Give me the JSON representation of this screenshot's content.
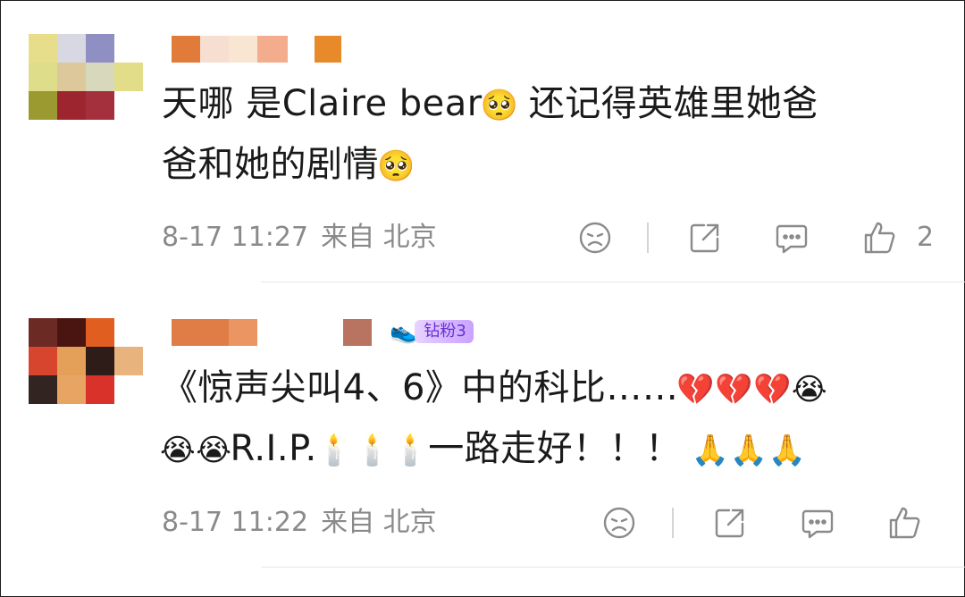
{
  "comments": [
    {
      "text_lines": [
        [
          {
            "t": "天哪 是Claire bear"
          },
          {
            "e": "🥺"
          },
          {
            "t": " 还记得英雄里她爸"
          }
        ],
        [
          {
            "t": "爸和她的剧情"
          },
          {
            "e": "🥺"
          }
        ]
      ],
      "time": "8-17 11:27",
      "location": "来自 北京",
      "likes": "2",
      "avatar_colors": [
        "#e8dd8a",
        "#d8d8e2",
        "#8f8fc4",
        "#ffffff",
        "#dedd8a",
        "#dcc89a",
        "#d8d8bc",
        "#e2dd88",
        "#9a9a30",
        "#9c2530",
        "#a3303c",
        "#ffffff"
      ],
      "name_colors": [
        "#e07b3a",
        "#f6ded0",
        "#f8e6d2",
        "#f3ac8c",
        "#e88a2a"
      ]
    },
    {
      "text_lines": [
        [
          {
            "t": "《惊声尖叫4、6》中的科比……"
          },
          {
            "e": "💔💔💔😭"
          }
        ],
        [
          {
            "e": "😭😭"
          },
          {
            "t": "R.I.P."
          },
          {
            "e": "🕯️🕯️🕯️"
          },
          {
            "t": "一路走好！！！ "
          },
          {
            "e": "🙏🙏🙏"
          }
        ]
      ],
      "time": "8-17 11:22",
      "location": "来自 北京",
      "likes": "",
      "badge": "钻粉3",
      "avatar_colors": [
        "#6b2b24",
        "#4a1410",
        "#e05f20",
        "#ffffff",
        "#d8452f",
        "#e4a058",
        "#2e1c18",
        "#e8b37c",
        "#322421",
        "#e8a463",
        "#d8322a",
        "#ffffff"
      ],
      "name_colors": [
        "#e07c45",
        "#ea9562",
        "#b87460"
      ]
    }
  ],
  "icons": [
    "sad-face-icon",
    "share-icon",
    "comment-icon",
    "thumbs-up-icon"
  ]
}
